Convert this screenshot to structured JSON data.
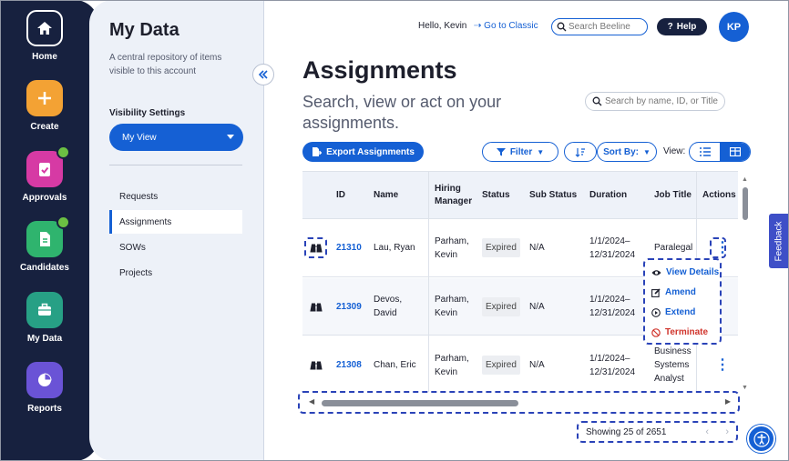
{
  "nav": {
    "items": [
      {
        "label": "Home",
        "icon": "home-icon",
        "color": "#ffffff"
      },
      {
        "label": "Create",
        "icon": "plus-icon",
        "color": "#f3a234"
      },
      {
        "label": "Approvals",
        "icon": "clipboard-check-icon",
        "color": "#d63aa4"
      },
      {
        "label": "Candidates",
        "icon": "document-icon",
        "color": "#2fb46e"
      },
      {
        "label": "My Data",
        "icon": "briefcase-icon",
        "color": "#27a085"
      },
      {
        "label": "Reports",
        "icon": "pie-chart-icon",
        "color": "#6a53d6"
      }
    ]
  },
  "panel": {
    "title": "My Data",
    "description": "A central repository of items visible to this account",
    "visibility_label": "Visibility Settings",
    "view_value": "My View",
    "links": [
      "Requests",
      "Assignments",
      "SOWs",
      "Projects"
    ],
    "active_link": "Assignments"
  },
  "topbar": {
    "greeting": "Hello, Kevin",
    "classic_link": "Go to Classic",
    "search_placeholder": "Search Beeline",
    "help_label": "Help",
    "avatar_initials": "KP"
  },
  "main": {
    "title": "Assignments",
    "subtitle": "Search, view or act on your assignments.",
    "grid_search_placeholder": "Search by name, ID, or Title",
    "export_label": "Export Assignments",
    "filter_label": "Filter",
    "sort_label": "Sort By:",
    "view_label": "View:"
  },
  "table": {
    "columns": [
      "ID",
      "Name",
      "Hiring Manager",
      "Status",
      "Sub Status",
      "Duration",
      "Job Title",
      "Actions"
    ],
    "rows": [
      {
        "id": "21310",
        "name": "Lau, Ryan",
        "manager": "Parham, Kevin",
        "status": "Expired",
        "sub_status": "N/A",
        "duration": "1/1/2024– 12/31/2024",
        "job_title": "Paralegal"
      },
      {
        "id": "21309",
        "name": "Devos, David",
        "manager": "Parham, Kevin",
        "status": "Expired",
        "sub_status": "N/A",
        "duration": "1/1/2024– 12/31/2024",
        "job_title": ""
      },
      {
        "id": "21308",
        "name": "Chan, Eric",
        "manager": "Parham, Kevin",
        "status": "Expired",
        "sub_status": "N/A",
        "duration": "1/1/2024– 12/31/2024",
        "job_title": "Business Systems Analyst"
      }
    ]
  },
  "action_menu": {
    "items": [
      {
        "label": "View Details",
        "icon": "eye-icon",
        "color": "#1560d4"
      },
      {
        "label": "Amend",
        "icon": "edit-icon",
        "color": "#1560d4"
      },
      {
        "label": "Extend",
        "icon": "play-circle-icon",
        "color": "#1560d4"
      },
      {
        "label": "Terminate",
        "icon": "ban-icon",
        "color": "#d0342c"
      }
    ]
  },
  "pagination": {
    "showing": "Showing 25 of 2651"
  },
  "feedback_label": "Feedback",
  "colors": {
    "brand": "#1560d4",
    "rail": "#17213f",
    "highlight": "#2a43b8"
  }
}
